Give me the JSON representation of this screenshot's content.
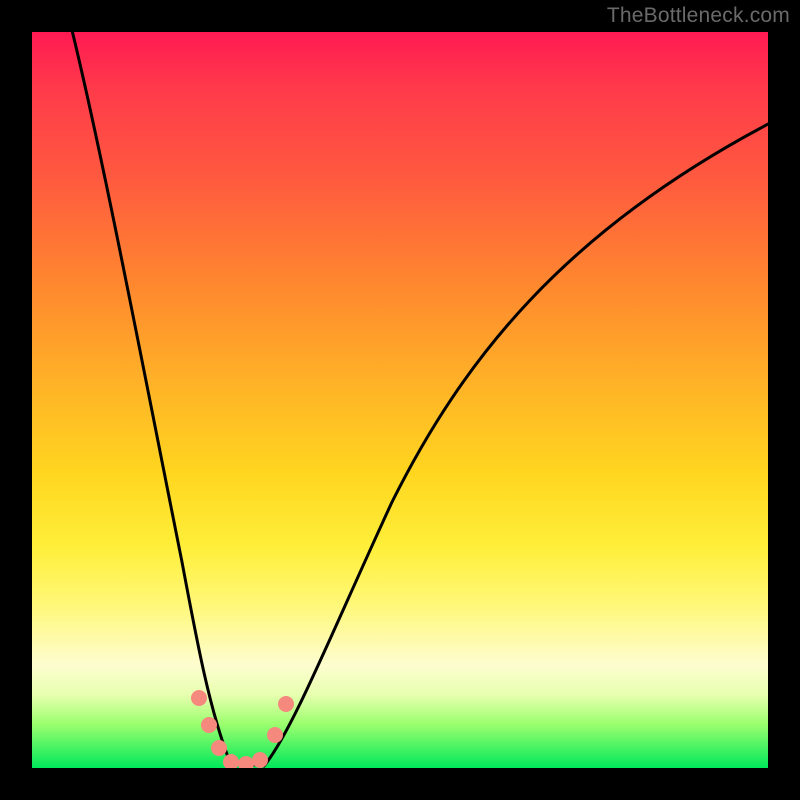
{
  "watermark": "TheBottleneck.com",
  "colors": {
    "background": "#000000",
    "curve_stroke": "#000000",
    "marker_fill": "#f5897e",
    "gradient_top": "#ff1a52",
    "gradient_bottom": "#00e85a"
  },
  "chart_data": {
    "type": "line",
    "title": "",
    "xlabel": "",
    "ylabel": "",
    "xlim": [
      0,
      100
    ],
    "ylim": [
      0,
      100
    ],
    "grid": false,
    "legend": "none",
    "note": "No axes, ticks or labels rendered; values are read from the gradient (green=0, red=100) and horizontal position (0–100).",
    "series": [
      {
        "name": "bottleneck-curve",
        "x": [
          5,
          10,
          15,
          20,
          23,
          25,
          27,
          29,
          30,
          32,
          35,
          40,
          45,
          50,
          55,
          60,
          65,
          70,
          75,
          80,
          85,
          90,
          95,
          100
        ],
        "y": [
          100,
          70,
          45,
          22,
          9,
          3,
          0,
          0,
          0,
          2,
          8,
          18,
          28,
          37,
          45,
          52,
          59,
          65,
          70,
          75,
          79,
          83,
          86,
          89
        ]
      }
    ],
    "markers": [
      {
        "x": 22.5,
        "y": 9
      },
      {
        "x": 24.0,
        "y": 5
      },
      {
        "x": 25.5,
        "y": 2
      },
      {
        "x": 27.0,
        "y": 0
      },
      {
        "x": 29.0,
        "y": 0
      },
      {
        "x": 31.0,
        "y": 2
      },
      {
        "x": 32.5,
        "y": 5
      },
      {
        "x": 34.0,
        "y": 9
      }
    ]
  }
}
